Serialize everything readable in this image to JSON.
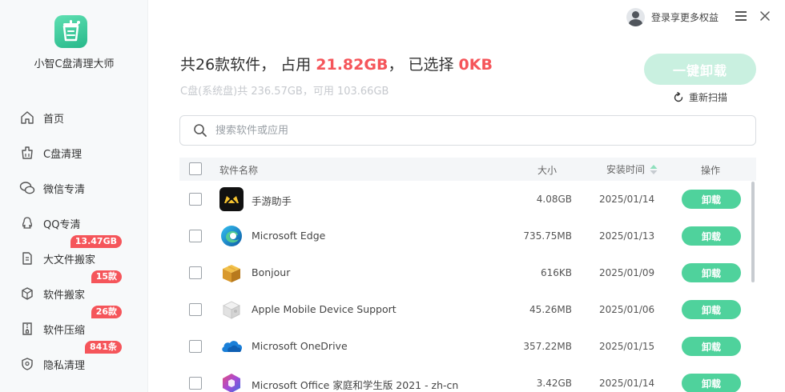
{
  "sidebar": {
    "app_name": "小智C盘清理大师",
    "items": [
      {
        "label": "首页",
        "icon": "home-icon",
        "badge": ""
      },
      {
        "label": "C盘清理",
        "icon": "broom-icon",
        "badge": ""
      },
      {
        "label": "微信专清",
        "icon": "wechat-icon",
        "badge": ""
      },
      {
        "label": "QQ专清",
        "icon": "qq-icon",
        "badge": ""
      },
      {
        "label": "大文件搬家",
        "icon": "file-move-icon",
        "badge": "13.47GB"
      },
      {
        "label": "软件搬家",
        "icon": "package-icon",
        "badge": "15款"
      },
      {
        "label": "软件压缩",
        "icon": "zip-icon",
        "badge": "26款"
      },
      {
        "label": "隐私清理",
        "icon": "shield-icon",
        "badge": "841条"
      }
    ]
  },
  "header": {
    "login_text": "登录享更多权益",
    "summary_prefix": "共26款软件，  占用 ",
    "summary_size": "21.82GB",
    "summary_mid": "，  已选择 ",
    "summary_selected": "0KB",
    "disk_info": "C盘(系统盘)共 236.57GB，可用 103.66GB",
    "uninstall_all_label": "一键卸载",
    "rescan_label": "重新扫描"
  },
  "search": {
    "placeholder": "搜索软件或应用"
  },
  "table": {
    "columns": {
      "name": "软件名称",
      "size": "大小",
      "date": "安装时间",
      "op": "操作"
    },
    "action_label": "卸载",
    "rows": [
      {
        "name": "手游助手",
        "size": "4.08GB",
        "date": "2025/01/14",
        "icon": "game-assistant-icon"
      },
      {
        "name": "Microsoft Edge",
        "size": "735.75MB",
        "date": "2025/01/13",
        "icon": "edge-icon"
      },
      {
        "name": "Bonjour",
        "size": "616KB",
        "date": "2025/01/09",
        "icon": "bonjour-icon"
      },
      {
        "name": "Apple Mobile Device Support",
        "size": "45.26MB",
        "date": "2025/01/06",
        "icon": "apple-device-icon"
      },
      {
        "name": "Microsoft OneDrive",
        "size": "357.22MB",
        "date": "2025/01/15",
        "icon": "onedrive-icon"
      },
      {
        "name": "Microsoft Office 家庭和学生版 2021 - zh-cn",
        "size": "3.42GB",
        "date": "2025/01/14",
        "icon": "office-icon"
      }
    ]
  },
  "colors": {
    "accent": "#4fd29c",
    "highlight": "#f5555a",
    "badge": "#f5555a",
    "disabled_button": "#c9f0e0"
  }
}
